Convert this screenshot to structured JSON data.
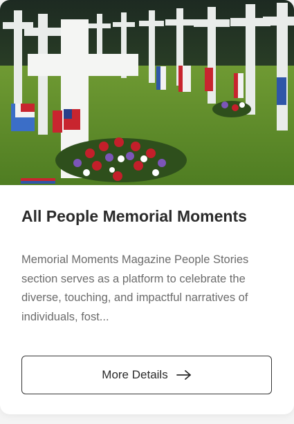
{
  "card": {
    "image": {
      "subject": "cemetery-with-white-crosses-and-flags"
    },
    "title": "All People Memorial Moments",
    "description": "Memorial Moments Magazine People Stories section serves as a platform to celebrate the diverse, touching, and impactful narratives of individuals, fost...",
    "button": {
      "label": "More Details",
      "icon": "arrow-right-icon"
    }
  },
  "colors": {
    "title": "#2a2a2a",
    "text": "#6b6b6b",
    "border": "#333333",
    "grass": "#5f8f2a"
  }
}
